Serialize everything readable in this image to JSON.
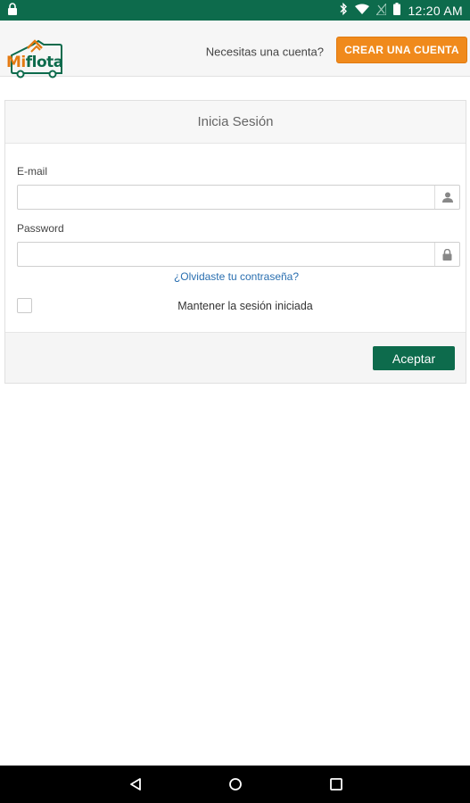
{
  "status_bar": {
    "time": "12:20 AM",
    "icons": [
      "lock-icon",
      "bluetooth-icon",
      "wifi-icon",
      "signal-icon",
      "battery-icon"
    ]
  },
  "header": {
    "logo": {
      "mi": "Mi",
      "flota": "flota"
    },
    "question": "Necesitas una cuenta?",
    "create_account_label": "CREAR UNA CUENTA"
  },
  "login": {
    "title": "Inicia Sesión",
    "email_label": "E-mail",
    "email_value": "",
    "password_label": "Password",
    "password_value": "",
    "forgot_label": "¿Olvidaste tu contraseña?",
    "remember_label": "Mantener la sesión iniciada",
    "remember_checked": false,
    "accept_label": "Aceptar"
  },
  "nav_bar": {
    "buttons": [
      "back-icon",
      "home-icon",
      "recents-icon"
    ]
  },
  "colors": {
    "brand_green": "#0d6b4c",
    "brand_orange": "#f08a1c",
    "link_blue": "#2a6fb0"
  }
}
